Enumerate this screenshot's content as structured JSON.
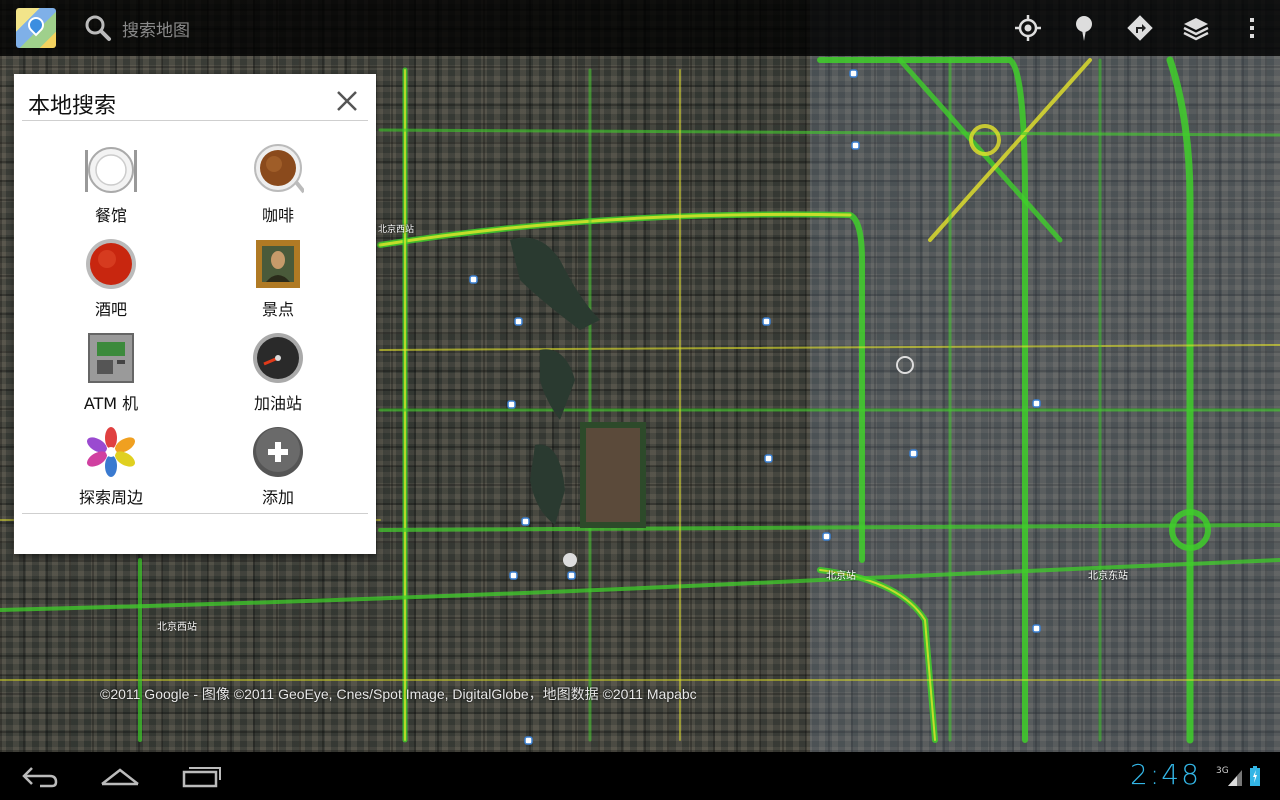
{
  "search_bar": {
    "placeholder": "搜索地图",
    "app_icon": "maps-app-icon",
    "search_icon": "search-icon",
    "actions": [
      {
        "name": "my-location-icon"
      },
      {
        "name": "places-pin-icon"
      },
      {
        "name": "directions-icon"
      },
      {
        "name": "layers-icon"
      },
      {
        "name": "overflow-menu-icon"
      }
    ]
  },
  "local_search": {
    "title": "本地搜索",
    "close_icon": "close-icon",
    "categories": [
      {
        "label": "餐馆",
        "icon": "restaurant-plate-icon"
      },
      {
        "label": "咖啡",
        "icon": "coffee-cup-icon"
      },
      {
        "label": "酒吧",
        "icon": "bottle-cap-icon"
      },
      {
        "label": "景点",
        "icon": "painting-icon"
      },
      {
        "label": "ATM 机",
        "icon": "atm-machine-icon"
      },
      {
        "label": "加油站",
        "icon": "fuel-gauge-icon"
      },
      {
        "label": "探索周边",
        "icon": "explore-flower-icon"
      },
      {
        "label": "添加",
        "icon": "add-plus-icon"
      }
    ]
  },
  "map": {
    "copyright": "©2011 Google - 图像 ©2011 GeoEye, Cnes/Spot Image, DigitalGlobe，地图数据 ©2011 Mapabc",
    "places": [
      "北京站",
      "北京东站",
      "北京西站",
      "北京西站"
    ]
  },
  "system_bar": {
    "time": "2:48",
    "network": "3G",
    "colors": {
      "clock": "#33b5e5"
    }
  }
}
